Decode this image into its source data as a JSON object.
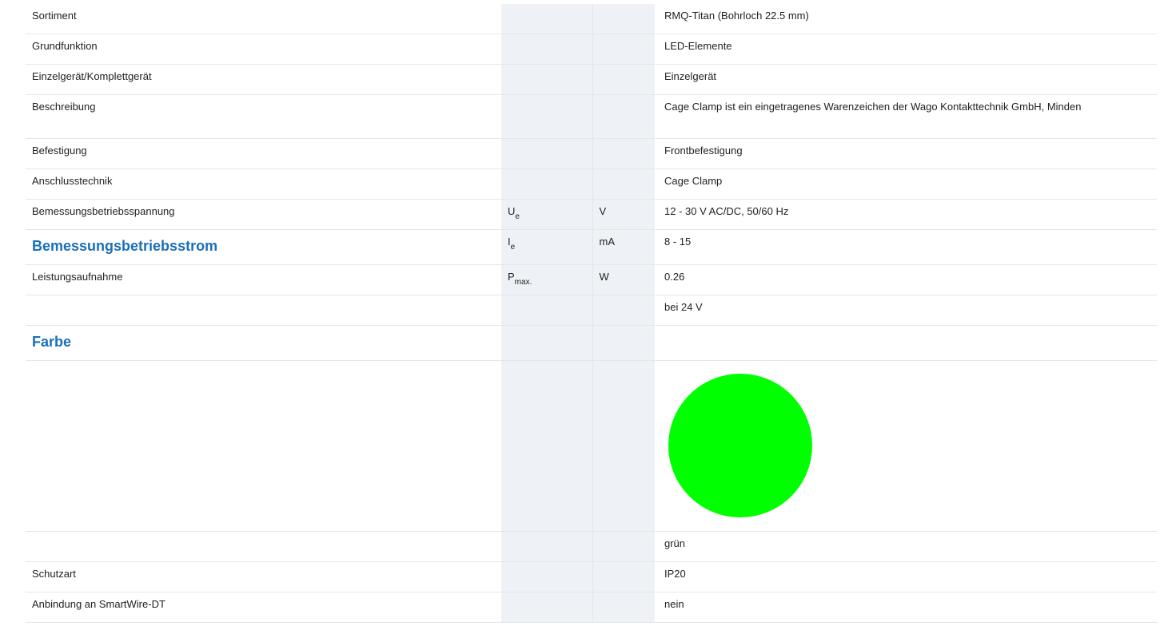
{
  "color_swatch": "#00ff00",
  "rows": [
    {
      "label": "Sortiment",
      "symbol": "",
      "subscript": "",
      "unit": "",
      "value": "RMQ-Titan (Bohrloch 22.5 mm)"
    },
    {
      "label": "Grundfunktion",
      "symbol": "",
      "subscript": "",
      "unit": "",
      "value": "LED-Elemente"
    },
    {
      "label": "Einzelgerät/Komplettgerät",
      "symbol": "",
      "subscript": "",
      "unit": "",
      "value": "Einzelgerät"
    },
    {
      "label": "Beschreibung",
      "symbol": "",
      "subscript": "",
      "unit": "",
      "value": "Cage Clamp ist ein eingetragenes Warenzeichen der Wago Kontakttechnik GmbH, Minden"
    },
    {
      "label": "Befestigung",
      "symbol": "",
      "subscript": "",
      "unit": "",
      "value": "Frontbefestigung"
    },
    {
      "label": "Anschlusstechnik",
      "symbol": "",
      "subscript": "",
      "unit": "",
      "value": "Cage Clamp"
    },
    {
      "label": "Bemessungsbetriebsspannung",
      "symbol": "U",
      "subscript": "e",
      "unit": "V",
      "value": "12 - 30 V AC/DC, 50/60 Hz"
    },
    {
      "label": "Bemessungsbetriebsstrom",
      "symbol": "I",
      "subscript": "e",
      "unit": "mA",
      "value": "8 - 15"
    },
    {
      "label": "Leistungsaufnahme",
      "symbol": "P",
      "subscript": "max.",
      "unit": "W",
      "value": "0.26"
    },
    {
      "label": "",
      "symbol": "",
      "subscript": "",
      "unit": "",
      "value": "bei 24 V"
    },
    {
      "label": "Farbe",
      "symbol": "",
      "subscript": "",
      "unit": "",
      "value": ""
    },
    {
      "label": "",
      "symbol": "",
      "subscript": "",
      "unit": "",
      "value": "grün"
    },
    {
      "label": "Schutzart",
      "symbol": "",
      "subscript": "",
      "unit": "",
      "value": "IP20"
    },
    {
      "label": "Anbindung an SmartWire-DT",
      "symbol": "",
      "subscript": "",
      "unit": "",
      "value": "nein"
    }
  ]
}
